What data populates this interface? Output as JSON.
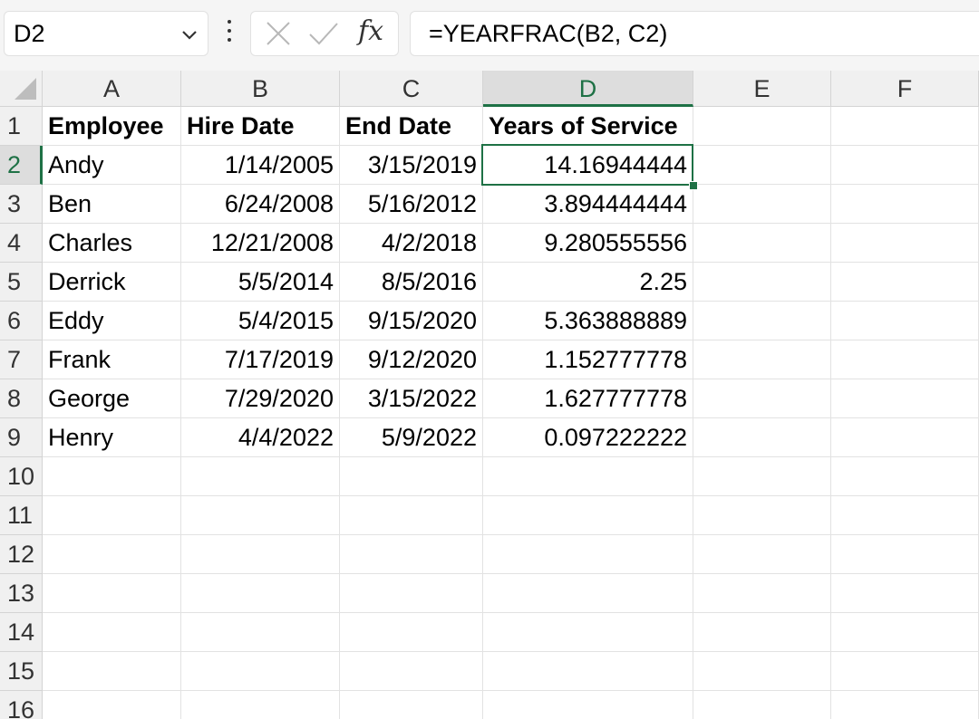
{
  "formula_bar": {
    "name_box": "D2",
    "formula": "=YEARFRAC(B2, C2)",
    "fx_label": "fx"
  },
  "columns": [
    "A",
    "B",
    "C",
    "D",
    "E",
    "F"
  ],
  "selected_column": "D",
  "rows": [
    "1",
    "2",
    "3",
    "4",
    "5",
    "6",
    "7",
    "8",
    "9",
    "10",
    "11",
    "12",
    "13",
    "14",
    "15",
    "16"
  ],
  "selected_row": "2",
  "table": {
    "headers": [
      "Employee",
      "Hire Date",
      "End Date",
      "Years of Service"
    ],
    "data": [
      [
        "Andy",
        "1/14/2005",
        "3/15/2019",
        "14.16944444"
      ],
      [
        "Ben",
        "6/24/2008",
        "5/16/2012",
        "3.894444444"
      ],
      [
        "Charles",
        "12/21/2008",
        "4/2/2018",
        "9.280555556"
      ],
      [
        "Derrick",
        "5/5/2014",
        "8/5/2016",
        "2.25"
      ],
      [
        "Eddy",
        "5/4/2015",
        "9/15/2020",
        "5.363888889"
      ],
      [
        "Frank",
        "7/17/2019",
        "9/12/2020",
        "1.152777778"
      ],
      [
        "George",
        "7/29/2020",
        "3/15/2022",
        "1.627777778"
      ],
      [
        "Henry",
        "4/4/2022",
        "5/9/2022",
        "0.097222222"
      ]
    ]
  },
  "colors": {
    "accent": "#1e7145",
    "header_bg": "#f0f0f0",
    "selected_header_bg": "#dddddd",
    "gridline": "#e2e2e2"
  }
}
